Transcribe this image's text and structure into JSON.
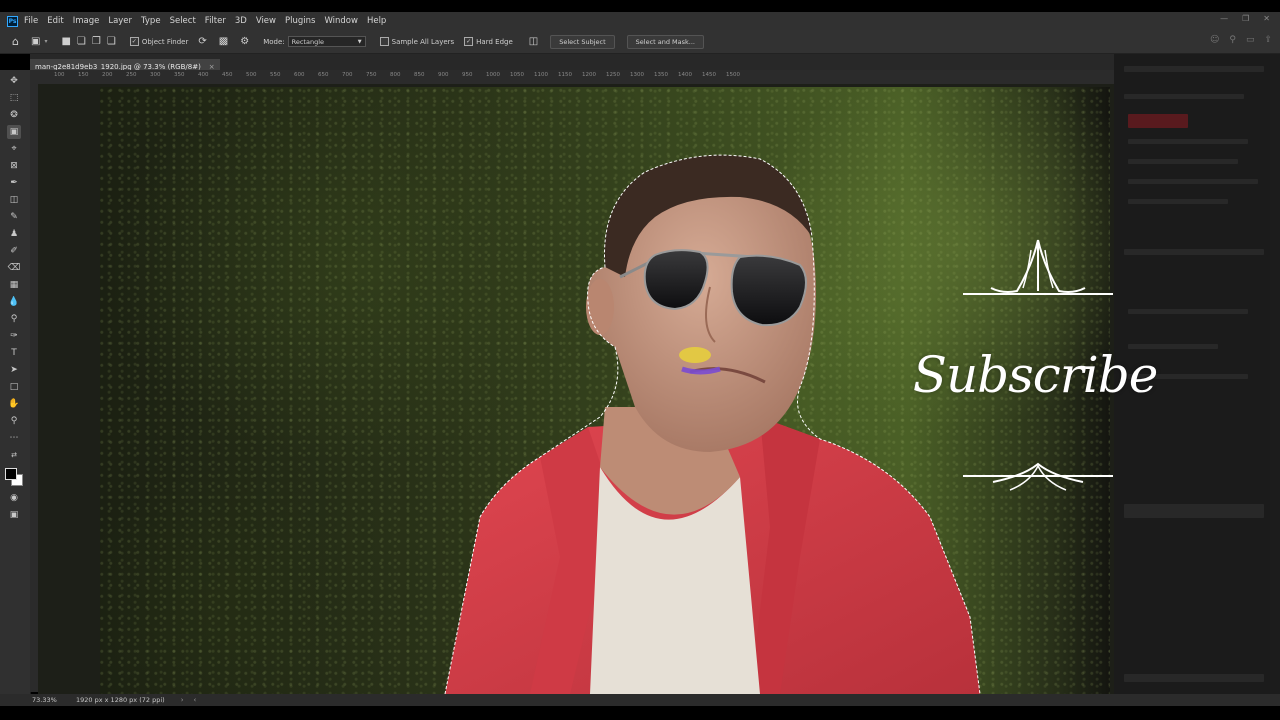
{
  "app": {
    "logo": "Ps"
  },
  "menu": [
    "File",
    "Edit",
    "Image",
    "Layer",
    "Type",
    "Select",
    "Filter",
    "3D",
    "View",
    "Plugins",
    "Window",
    "Help"
  ],
  "options": {
    "object_finder": "Object Finder",
    "mode_label": "Mode:",
    "mode_value": "Rectangle",
    "sample_all_layers": "Sample All Layers",
    "hard_edge": "Hard Edge",
    "select_subject": "Select Subject",
    "select_and_mask": "Select and Mask..."
  },
  "document": {
    "tab_title": "man-g2e81d9eb3_1920.jpg @ 73.3% (RGB/8#)"
  },
  "ruler_ticks": [
    "100",
    "150",
    "200",
    "250",
    "300",
    "350",
    "400",
    "450",
    "500",
    "550",
    "600",
    "650",
    "700",
    "750",
    "800",
    "850",
    "900",
    "950",
    "1000",
    "1050",
    "1100",
    "1150",
    "1200",
    "1250",
    "1300",
    "1350",
    "1400",
    "1450",
    "1500"
  ],
  "status": {
    "zoom": "73.33%",
    "dimensions": "1920 px x 1280 px (72 ppi)"
  },
  "overlay": {
    "text": "Subscribe"
  },
  "colors": {
    "jacket": "#d8424c",
    "shirt": "#e6e0d6",
    "skin": "#c99a82",
    "brush_yellow": "#e8d13a",
    "brush_purple": "#7a4bd1"
  }
}
